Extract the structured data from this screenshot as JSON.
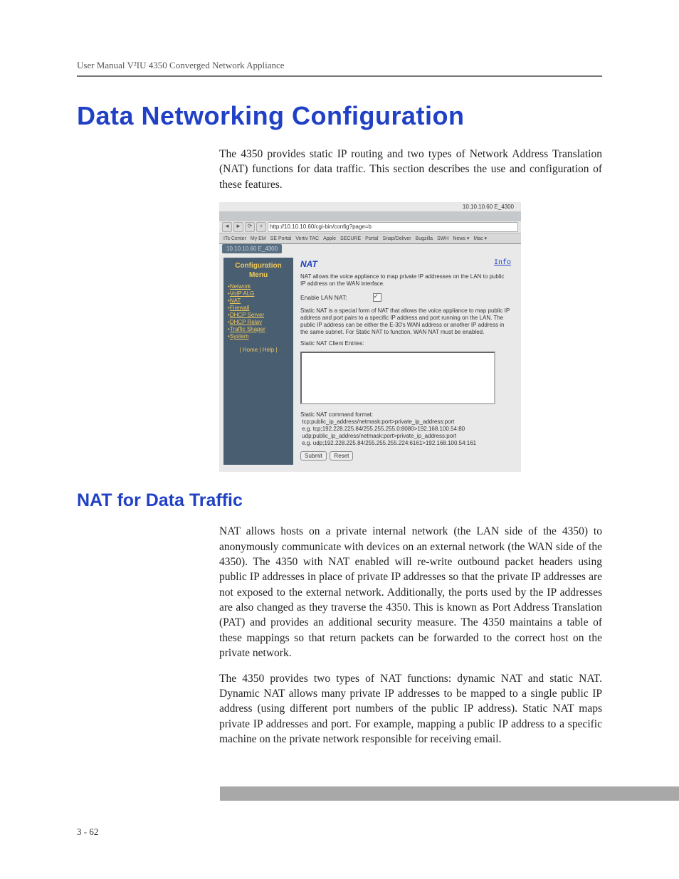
{
  "header": {
    "running_head": "User Manual V²IU 4350 Converged Network Appliance"
  },
  "section": {
    "title": "Data Networking Configuration",
    "intro": "The 4350 provides static IP routing and two types of Network Address Translation (NAT) functions for data traffic. This section describes the use and configuration of these features."
  },
  "screenshot": {
    "ip_display_top": "10.10.10.60 E_4300",
    "chip_text": "10.10.10.60 E_4300",
    "address_bar": "http://10.10.10.60/cgi-bin/config?page=b",
    "bookmarks": [
      "ITs Center",
      "My EM",
      "SE Portal",
      "Vertiv TAC",
      "Apple",
      "SECURE",
      "Portal",
      "Snap/Deliver",
      "Bugzilla",
      "SWH",
      "News ▾",
      "Mac ▾"
    ],
    "menu": {
      "title": "Configuration",
      "subtitle": "Menu",
      "items": [
        "Network",
        "VoIP ALG",
        "NAT",
        "Firewall",
        "DHCP Server",
        "DHCP Relay",
        "Traffic Shaper",
        "System"
      ],
      "footer_home": "Home",
      "footer_help": "Help"
    },
    "pane": {
      "title": "NAT",
      "info": "Info",
      "intro": "NAT allows the voice appliance to map private IP addresses on the LAN to public IP address on the WAN interface.",
      "enable_label": "Enable LAN NAT:",
      "enable_checked": true,
      "static_desc": "Static NAT is a special form of NAT that allows the voice appliance to map public IP address and port pairs to a specific IP address and port running on the LAN. The public IP address can be either the E-30's WAN address or another IP address in the same subnet. For Static NAT to function, WAN NAT must be enabled.",
      "entries_label": "Static NAT Client Entries:",
      "cmd_heading": "Static NAT command format:",
      "cmd_line1": "tcp;public_ip_address/netmask:port>private_ip_address:port",
      "cmd_line2": "e.g. tcp;192.228.225.84/255.255.255.0:8080>192.168.100.54:80",
      "cmd_line3": "udp;public_ip_address/netmask:port>private_ip_address:port",
      "cmd_line4": "e.g. udp;192.228.225.84/255.255.255.224:6161>192.168.100.54:161",
      "btn_submit": "Submit",
      "btn_reset": "Reset"
    }
  },
  "subsection": {
    "title": "NAT for Data Traffic",
    "p1": "NAT allows hosts on a private internal network (the LAN side of the 4350) to anonymously communicate with devices on an external network (the WAN side of the 4350). The 4350 with NAT enabled will re-write outbound packet headers using public IP addresses in place of private IP addresses so that the private IP addresses are not exposed to the external network. Additionally, the ports used by the IP addresses are also changed as they traverse the 4350. This is known as Port Address Translation (PAT) and provides an additional security measure. The 4350 maintains a table of these mappings so that return packets can be forwarded to the correct host on the private network.",
    "p2": "The 4350 provides two types of NAT functions: dynamic NAT and static NAT. Dynamic NAT allows many private IP addresses to be mapped to a single public IP address (using different port numbers of the public IP address). Static NAT maps private IP addresses and port. For example, mapping a public IP address to a specific machine on the private network responsible for receiving email."
  },
  "footer": {
    "page": "3 - 62"
  }
}
